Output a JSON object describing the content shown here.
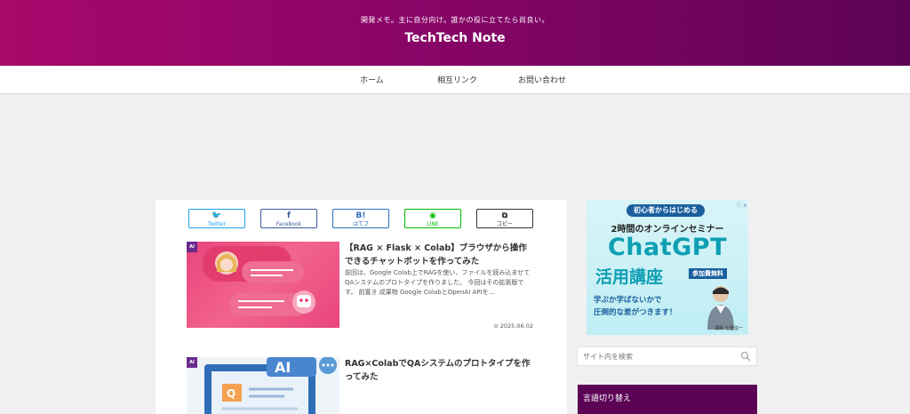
{
  "header": {
    "tagline": "開発メモ。主に自分向け。誰かの役に立てたら尚良い。",
    "title": "TechTech Note"
  },
  "nav": {
    "items": [
      {
        "label": "ホーム"
      },
      {
        "label": "相互リンク"
      },
      {
        "label": "お問い合わせ"
      }
    ]
  },
  "share": {
    "buttons": [
      {
        "icon": "🐦",
        "label": "Twitter"
      },
      {
        "icon": "f",
        "label": "Facebook"
      },
      {
        "icon": "B!",
        "label": "はてブ"
      },
      {
        "icon": "◉",
        "label": "LINE"
      },
      {
        "icon": "⧉",
        "label": "コピー"
      }
    ]
  },
  "articles": [
    {
      "badge": "AI",
      "title": "【RAG × Flask × Colab】ブラウザから操作できるチャットボットを作ってみた",
      "excerpt": "前回は、Google Colab上でRAGを使い、ファイルを読み込ませてQAシステムのプロトタイプを作りました。 今回はその拡張版です。 前置き 成果物 Google ColabとOpenAI APIを…",
      "date": "⊙ 2025.06.02"
    },
    {
      "badge": "AI",
      "title": "RAG×ColabでQAシステムのプロトタイプを作ってみた",
      "thumb_text": "AI",
      "thumb_q": "Q"
    }
  ],
  "sidebar": {
    "ad": {
      "pill": "初心者からはじめる",
      "line1": "2時間のオンラインセミナー",
      "big": "ChatGPT",
      "katsuyou": "活用講座",
      "free": "参加費無料",
      "sub1": "学ぶか学ばないかで",
      "sub2": "圧倒的な差がつきます！",
      "lecturer": "講師 七里信一",
      "info": "ⓘ ⅹ"
    },
    "search": {
      "placeholder": "サイト内を検索"
    },
    "language": {
      "title": "言語切り替え"
    }
  },
  "colors": {
    "header_start": "#a8086a",
    "header_end": "#5c0356",
    "accent": "#5c0356"
  }
}
